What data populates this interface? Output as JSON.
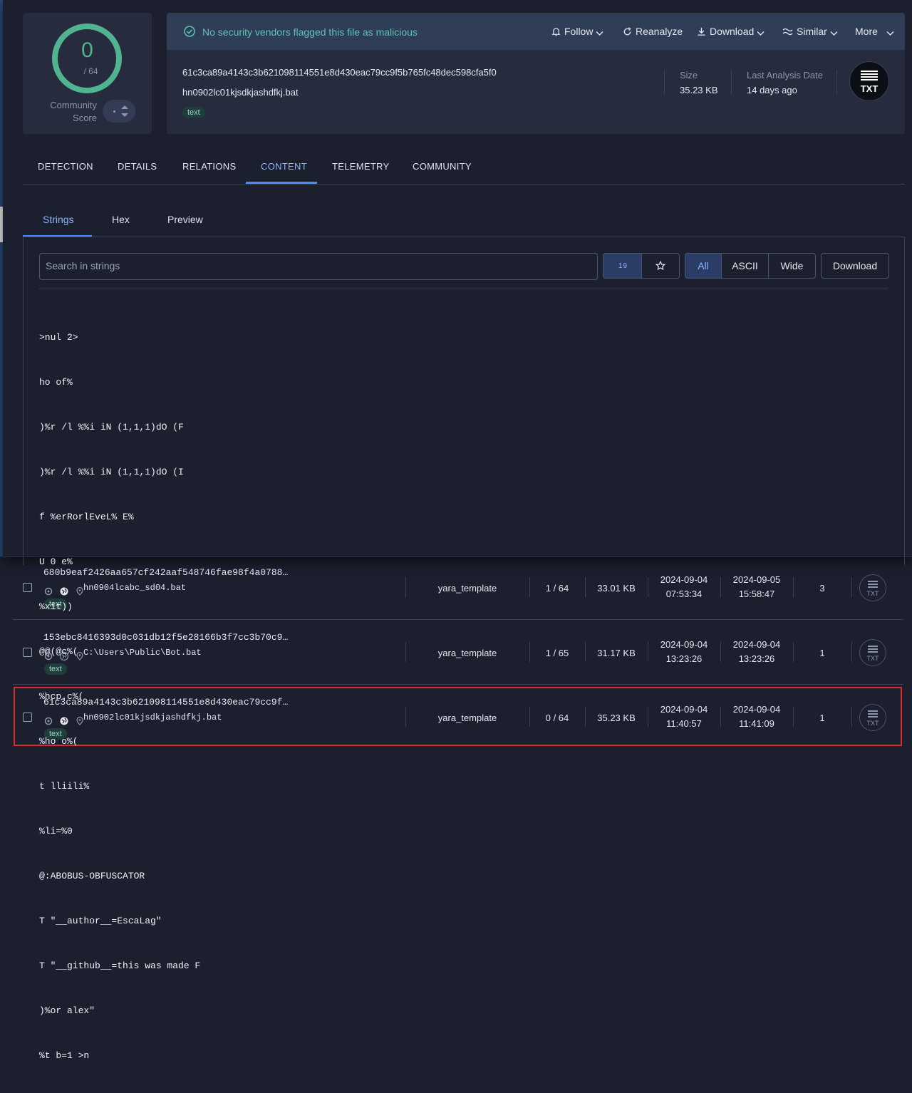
{
  "score": {
    "value": "0",
    "total": "/ 64",
    "community_label": "Community Score",
    "ring_color": "#4fb48f"
  },
  "banner": {
    "message": "No security vendors flagged this file as malicious",
    "actions": {
      "follow": "Follow",
      "reanalyze": "Reanalyze",
      "download": "Download",
      "similar": "Similar",
      "more": "More"
    }
  },
  "file": {
    "hash": "61c3ca89a4143c3b621098114551e8d430eac79cc9f5b765fc48dec598cfa5f0",
    "name": "hn0902lc01kjsdkjashdfkj.bat",
    "tag": "text",
    "size_label": "Size",
    "size": "35.23 KB",
    "last_analysis_label": "Last Analysis Date",
    "last_analysis": "14 days ago",
    "type_badge": "TXT"
  },
  "main_tabs": [
    "DETECTION",
    "DETAILS",
    "RELATIONS",
    "CONTENT",
    "TELEMETRY",
    "COMMUNITY"
  ],
  "sub_tabs": [
    "Strings",
    "Hex",
    "Preview"
  ],
  "strings_toolbar": {
    "search_placeholder": "Search in strings",
    "sort_icon_text": "1 9",
    "filters": [
      "All",
      "ASCII",
      "Wide"
    ],
    "download": "Download"
  },
  "strings": [
    ">nul 2>",
    "ho of%",
    ")%r /l %%i iN (1,1,1)dO (F",
    ")%r /l %%i iN (1,1,1)dO (I",
    "f %erRorlEveL% E%",
    "U 0 e%",
    "%xit))",
    "@@(@c%(",
    "%hcp.c%(",
    "%ho o%(",
    "t lliili%",
    "%li=%0",
    "@:ABOBUS-OBFUSCATOR",
    "T \"__author__=EscaLag\"",
    "T \"__github__=this was made F",
    ")%or alex\"",
    "%t b=1 >n"
  ],
  "rows": [
    {
      "hash": "680b9eaf2426aa657cf242aaf548746fae98f4a0788…",
      "name": "hn0904lcabc_sd04.bat",
      "tag": "text",
      "rule": "yara_template",
      "detections": "1 / 64",
      "size": "33.01 KB",
      "first_date": "2024-09-04",
      "first_time": "07:53:34",
      "last_date": "2024-09-05",
      "last_time": "15:58:47",
      "count": "3",
      "badge": "TXT"
    },
    {
      "hash": "153ebc8416393d0c031db12f5e28166b3f7cc3b70c9…",
      "name": "C:\\Users\\Public\\Bot.bat",
      "tag": "text",
      "rule": "yara_template",
      "detections": "1 / 65",
      "size": "31.17 KB",
      "first_date": "2024-09-04",
      "first_time": "13:23:26",
      "last_date": "2024-09-04",
      "last_time": "13:23:26",
      "count": "1",
      "badge": "TXT"
    },
    {
      "hash": "61c3ca89a4143c3b621098114551e8d430eac79cc9f…",
      "name": "hn0902lc01kjsdkjashdfkj.bat",
      "tag": "text",
      "rule": "yara_template",
      "detections": "0 / 64",
      "size": "35.23 KB",
      "first_date": "2024-09-04",
      "first_time": "11:40:57",
      "last_date": "2024-09-04",
      "last_time": "11:41:09",
      "count": "1",
      "badge": "TXT"
    }
  ],
  "colors": {
    "accent": "#4b8df8",
    "success": "#5ec4b0",
    "highlight": "#d92b2b"
  }
}
